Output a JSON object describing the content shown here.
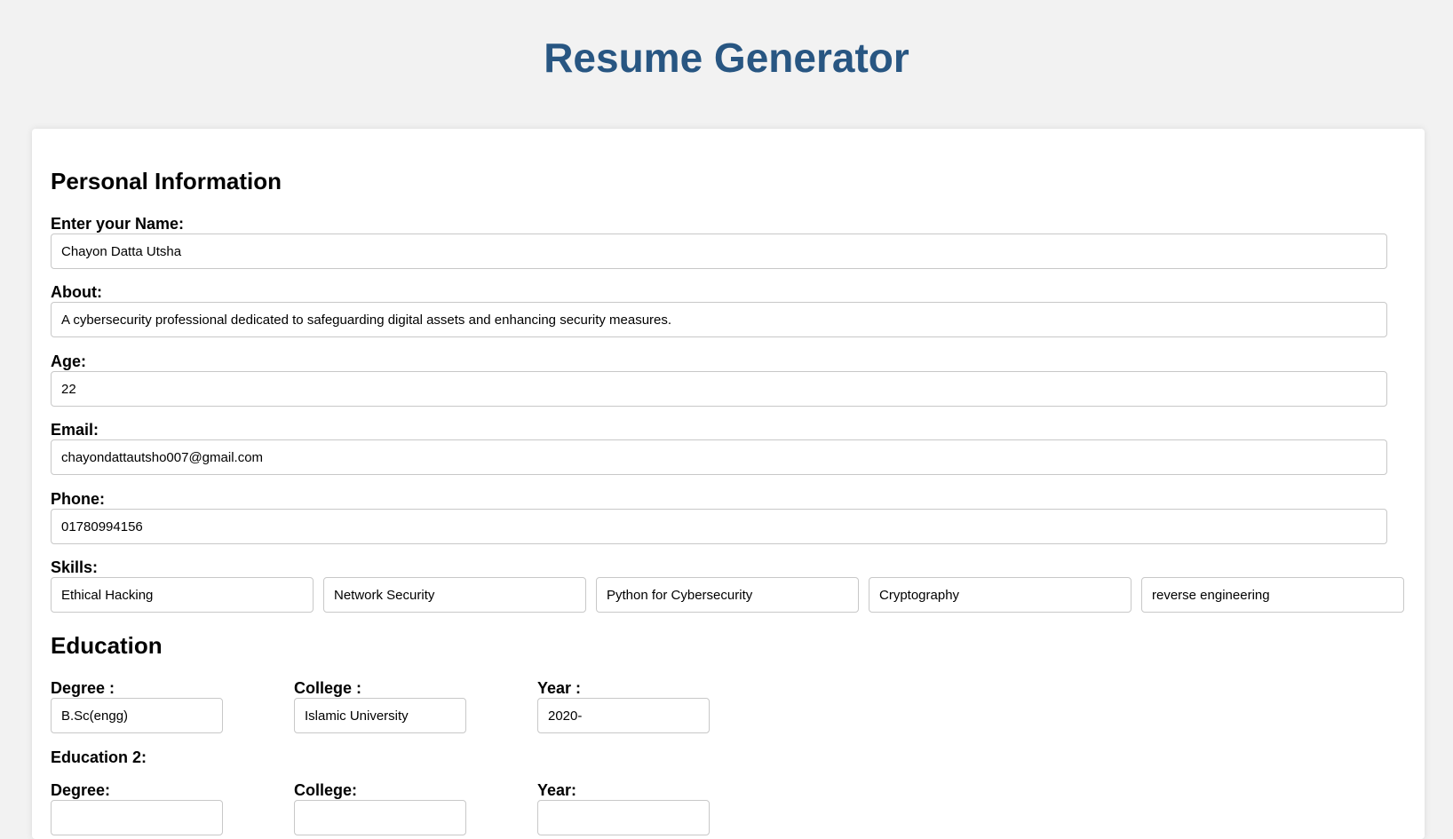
{
  "header": {
    "title": "Resume Generator"
  },
  "personal": {
    "heading": "Personal Information",
    "name": {
      "label": "Enter your Name:",
      "value": "Chayon Datta Utsha"
    },
    "about": {
      "label": "About:",
      "value": "A cybersecurity professional dedicated to safeguarding digital assets and enhancing security measures."
    },
    "age": {
      "label": "Age:",
      "value": "22"
    },
    "email": {
      "label": "Email:",
      "value": "chayondattautsho007@gmail.com"
    },
    "phone": {
      "label": "Phone:",
      "value": "01780994156"
    },
    "skills": {
      "label": "Skills:",
      "values": [
        "Ethical Hacking",
        "Network Security",
        "Python for Cybersecurity",
        "Cryptography",
        "reverse engineering"
      ]
    }
  },
  "education": {
    "heading": "Education",
    "entry1": {
      "degree_label": "Degree :",
      "degree_value": "B.Sc(engg)",
      "college_label": "College :",
      "college_value": "Islamic University",
      "year_label": "Year :",
      "year_value": "2020-"
    },
    "entry2": {
      "heading": "Education 2:",
      "degree_label": "Degree:",
      "degree_value": "",
      "college_label": "College:",
      "college_value": "",
      "year_label": "Year:",
      "year_value": ""
    }
  },
  "colors": {
    "title": "#285682",
    "background": "#f2f2f2",
    "card": "#ffffff",
    "input_border": "#c8c8c8"
  }
}
